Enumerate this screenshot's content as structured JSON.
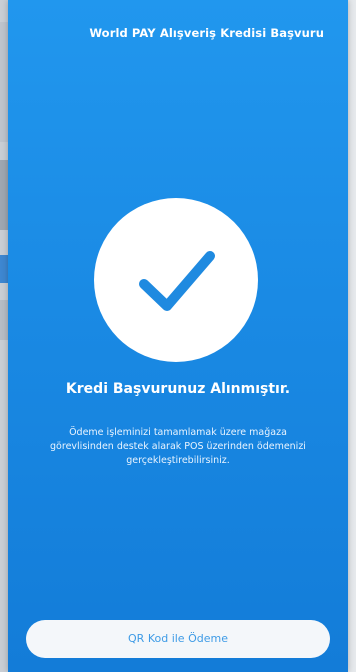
{
  "header": {
    "title": "World PAY Alışveriş Kredisi Başvuru"
  },
  "success": {
    "icon": "checkmark-icon",
    "heading": "Kredi Başvurunuz Alınmıştır.",
    "description": "Ödeme işleminizi tamamlamak üzere mağaza görevlisinden destek alarak POS üzerinden ödemenizi gerçekleştirebilirsiniz."
  },
  "actions": {
    "qr_button_label": "QR Kod ile Ödeme"
  },
  "colors": {
    "primary_blue": "#1a8ae4",
    "check_blue": "#1f8ae0",
    "button_bg": "#f4f7fa",
    "button_text": "#3e9be6"
  }
}
